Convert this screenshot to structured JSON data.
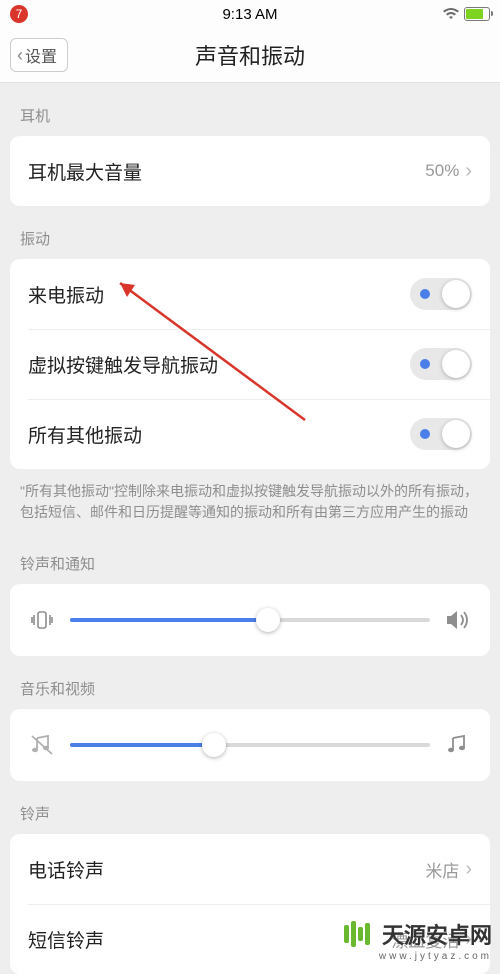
{
  "status": {
    "time": "9:13 AM",
    "notif_count": "7"
  },
  "header": {
    "back_label": "设置",
    "title": "声音和振动"
  },
  "sections": {
    "headphones": {
      "header": "耳机",
      "max_volume_label": "耳机最大音量",
      "max_volume_value": "50%"
    },
    "vibration": {
      "header": "振动",
      "incoming_call_label": "来电振动",
      "virtual_key_label": "虚拟按键触发导航振动",
      "other_label": "所有其他振动",
      "description": "\"所有其他振动\"控制除来电振动和虚拟按键触发导航振动以外的所有振动，包括短信、邮件和日历提醒等通知的振动和所有由第三方应用产生的振动"
    },
    "ringtone_notif": {
      "header": "铃声和通知",
      "slider_percent": 55
    },
    "music_video": {
      "header": "音乐和视频",
      "slider_percent": 40
    },
    "ringtones": {
      "header": "铃声",
      "phone_label": "电话铃声",
      "phone_value": "米店",
      "sms_label": "短信铃声",
      "sms_value": "漂血复活"
    }
  },
  "watermark": {
    "text": "天源安卓网",
    "url": "www.jytyaz.com"
  }
}
